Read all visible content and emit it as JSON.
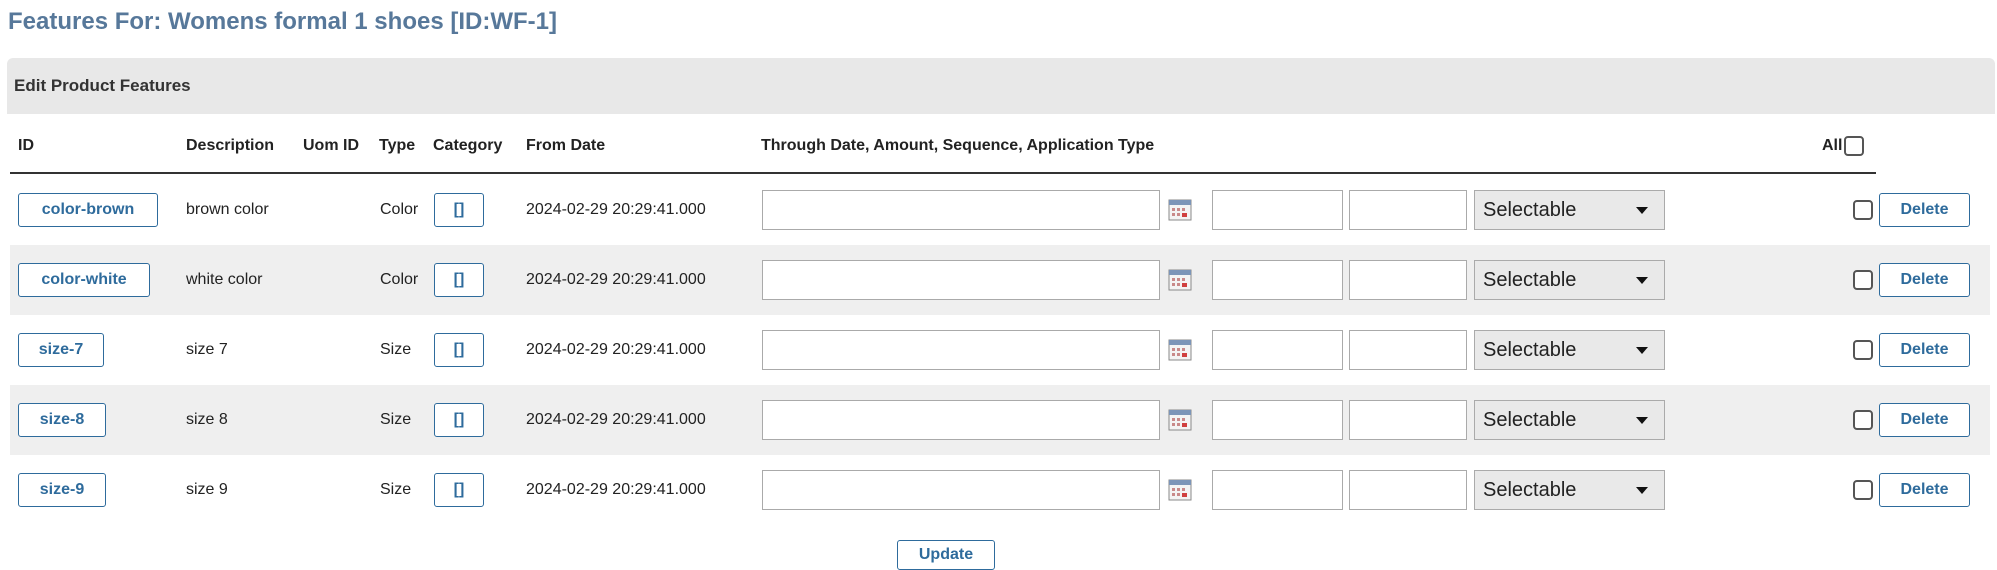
{
  "page": {
    "title": "Features For: Womens formal 1 shoes [ID:WF-1]"
  },
  "panel": {
    "title": "Edit Product Features"
  },
  "columns": {
    "id": "ID",
    "description": "Description",
    "uom": "Uom ID",
    "type": "Type",
    "category": "Category",
    "from_date": "From Date",
    "through": "Through Date, Amount, Sequence, Application Type",
    "all": "All"
  },
  "rows": [
    {
      "id": "color-brown",
      "description": "brown color",
      "type": "Color",
      "category": "[]",
      "from_date": "2024-02-29 20:29:41.000",
      "through_date": "",
      "amount": "",
      "sequence": "",
      "application_type": "Selectable",
      "delete_label": "Delete"
    },
    {
      "id": "color-white",
      "description": "white color",
      "type": "Color",
      "category": "[]",
      "from_date": "2024-02-29 20:29:41.000",
      "through_date": "",
      "amount": "",
      "sequence": "",
      "application_type": "Selectable",
      "delete_label": "Delete"
    },
    {
      "id": "size-7",
      "description": "size 7",
      "type": "Size",
      "category": "[]",
      "from_date": "2024-02-29 20:29:41.000",
      "through_date": "",
      "amount": "",
      "sequence": "",
      "application_type": "Selectable",
      "delete_label": "Delete"
    },
    {
      "id": "size-8",
      "description": "size 8",
      "type": "Size",
      "category": "[]",
      "from_date": "2024-02-29 20:29:41.000",
      "through_date": "",
      "amount": "",
      "sequence": "",
      "application_type": "Selectable",
      "delete_label": "Delete"
    },
    {
      "id": "size-9",
      "description": "size 9",
      "type": "Size",
      "category": "[]",
      "from_date": "2024-02-29 20:29:41.000",
      "through_date": "",
      "amount": "",
      "sequence": "",
      "application_type": "Selectable",
      "delete_label": "Delete"
    }
  ],
  "actions": {
    "update_label": "Update"
  },
  "colors": {
    "title": "#57789a",
    "accent": "#2e6b9c",
    "header_bg": "#e8e8e8",
    "row_alt": "#efefef"
  }
}
